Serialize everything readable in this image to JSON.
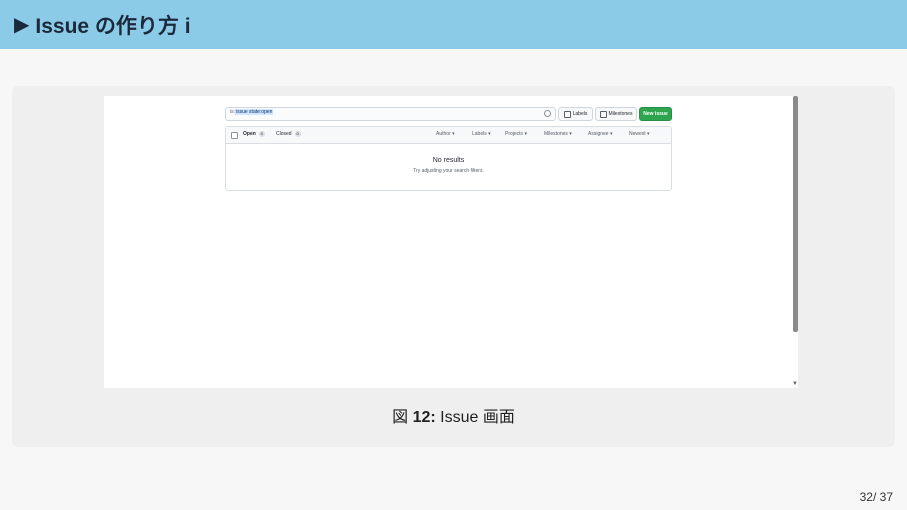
{
  "slide": {
    "title": "Issue の作り方 i",
    "title_arrow": "▶",
    "caption_prefix": "図",
    "caption_number": "12:",
    "caption_text": "Issue 画面",
    "page": "32/ 37"
  },
  "github": {
    "search_query_prefix": "is:",
    "search_query_highlight": "issue state:open",
    "labels_button": "Labels",
    "milestones_button": "Milestones",
    "new_issue_button": "New issue",
    "tabs": [
      {
        "label": "Open",
        "count": "0"
      },
      {
        "label": "Closed",
        "count": "0"
      }
    ],
    "filters": [
      "Author ▾",
      "Labels ▾",
      "Projects ▾",
      "Milestones ▾",
      "Assignee ▾",
      "Newest ▾"
    ],
    "empty_title": "No results",
    "empty_hint": "Try adjusting your search filters."
  },
  "colors": {
    "title_bar": "#8ccbe8",
    "new_issue_green": "#2da44e"
  }
}
